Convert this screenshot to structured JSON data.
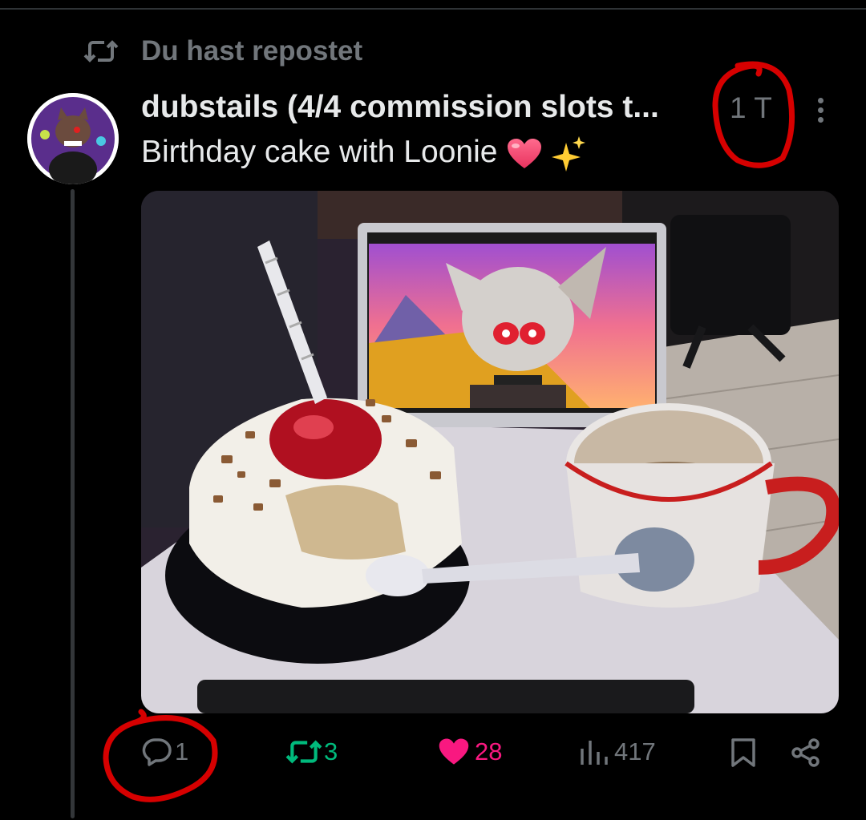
{
  "repost_banner": {
    "icon": "repost-icon",
    "text": "Du hast repostet"
  },
  "post": {
    "author": "dubstails (4/4 commission slots t...",
    "time": "1 T",
    "text": "Birthday cake with Loonie",
    "emojis": [
      "heart-icon",
      "sparkles-icon"
    ]
  },
  "media": {
    "alt": "Birthday cake with candle, coffee mug and laptop showing Loonie"
  },
  "actions": {
    "reply_count": "1",
    "repost_count": "3",
    "like_count": "28",
    "view_count": "417"
  },
  "colors": {
    "background": "#000000",
    "secondary_text": "#71767b",
    "repost_green": "#00ba7c",
    "like_pink": "#f91880",
    "annotation_red": "#d60000"
  }
}
